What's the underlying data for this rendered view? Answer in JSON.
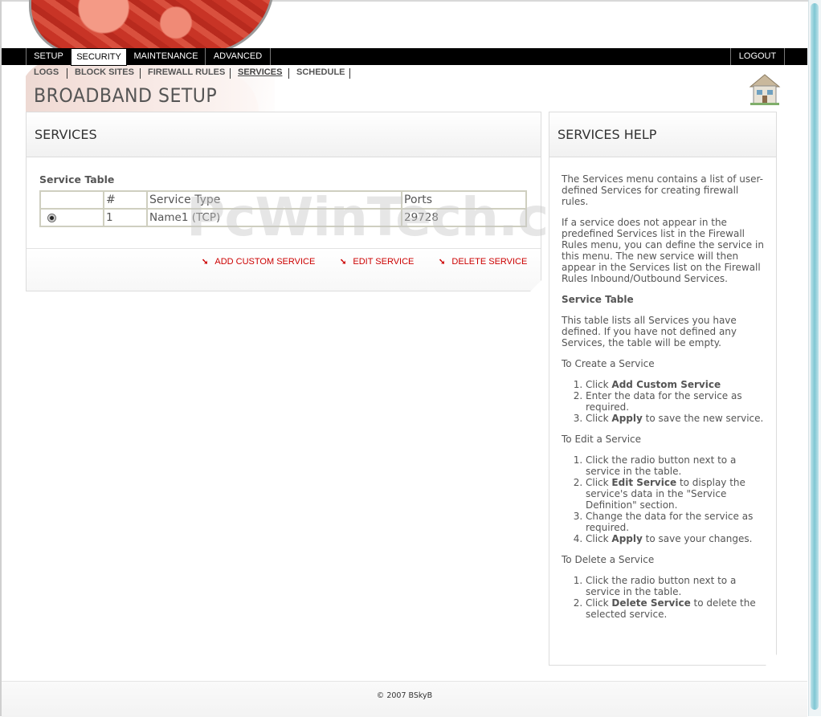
{
  "nav": {
    "tabs": [
      {
        "label": "SETUP"
      },
      {
        "label": "SECURITY"
      },
      {
        "label": "MAINTENANCE"
      },
      {
        "label": "ADVANCED"
      }
    ],
    "logout": "LOGOUT"
  },
  "subnav": {
    "items": [
      {
        "label": "LOGS"
      },
      {
        "label": "BLOCK SITES"
      },
      {
        "label": "FIREWALL RULES"
      },
      {
        "label": "SERVICES"
      },
      {
        "label": "SCHEDULE"
      }
    ]
  },
  "page_title": "BROADBAND SETUP",
  "services": {
    "title": "SERVICES",
    "table_title": "Service Table",
    "columns": [
      "",
      "#",
      "Service Type",
      "Ports"
    ],
    "rows": [
      {
        "num": "1",
        "type": "Name1 (TCP)",
        "ports": "29728",
        "selected": true
      }
    ],
    "actions": {
      "add": "ADD CUSTOM SERVICE",
      "edit": "EDIT SERVICE",
      "delete": "DELETE SERVICE"
    }
  },
  "watermark": "PcWinTech.com",
  "help": {
    "title": "SERVICES HELP",
    "intro": "The Services menu contains a list of user-defined Services for creating firewall rules.",
    "para2": "If a service does not appear in the predefined Services list in the Firewall Rules menu, you can define the service in this menu. The new service will then appear in the Services list on the Firewall Rules Inbound/Outbound Services.",
    "table_heading": "Service Table",
    "table_text": "This table lists all Services you have defined. If you have not defined any Services, the table will be empty.",
    "create_heading": "To Create a Service",
    "create_steps": {
      "s1_pre": "Click ",
      "s1_bold": "Add Custom Service",
      "s2": "Enter the data for the service as required.",
      "s3_pre": "Click ",
      "s3_bold": "Apply",
      "s3_post": " to save the new service."
    },
    "edit_heading": "To Edit a Service",
    "edit_steps": {
      "s1": "Click the radio button next to a service in the table.",
      "s2_pre": "Click ",
      "s2_bold": "Edit Service",
      "s2_post": " to display the service's data in the \"Service Definition\" section.",
      "s3": "Change the data for the service as required.",
      "s4_pre": "Click ",
      "s4_bold": "Apply",
      "s4_post": " to save your changes."
    },
    "delete_heading": "To Delete a Service",
    "delete_steps": {
      "s1": "Click the radio button next to a service in the table.",
      "s2_pre": "Click ",
      "s2_bold": "Delete Service",
      "s2_post": " to delete the selected service."
    }
  },
  "footer": "© 2007 BSkyB"
}
